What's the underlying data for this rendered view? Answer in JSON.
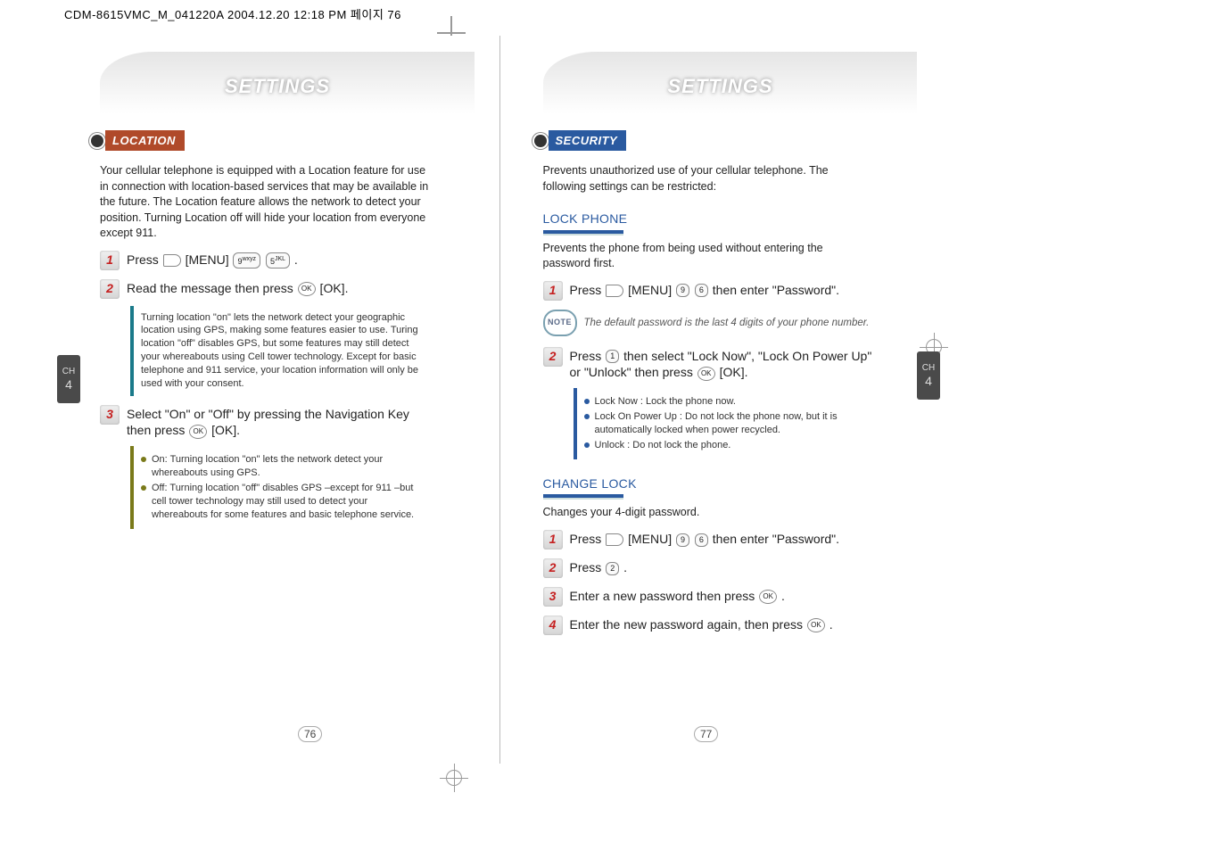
{
  "printhead": "CDM-8615VMC_M_041220A  2004.12.20 12:18 PM  페이지 76",
  "chapter": {
    "label": "CH",
    "num": "4"
  },
  "left": {
    "heading": "SETTINGS",
    "section": {
      "label": "LOCATION",
      "color": "#b04a2a"
    },
    "intro": "Your cellular telephone is equipped with a Location feature for use in connection with location-based services that may be available in the future. The Location feature allows the network to detect your position. Turning Location off will hide your location from everyone except 911.",
    "steps": [
      {
        "n": "1",
        "txt_a": "Press ",
        "txt_b": " [MENU] ",
        "keys": [
          "9",
          "5"
        ],
        "txt_c": " ."
      },
      {
        "n": "2",
        "txt_a": "Read the message then press ",
        "ok": true,
        "txt_b": " [OK]."
      },
      {
        "n": "3",
        "txt_a": "Select \"On\" or \"Off\" by pressing the Navigation Key then press ",
        "ok": true,
        "txt_b": " [OK]."
      }
    ],
    "box1": "Turning location \"on\" lets the network detect your geographic location using GPS, making some features easier to use. Turing location \"off\" disables GPS, but some features may still detect your whereabouts using Cell tower technology. Except for basic telephone and 911 service, your location information will only be used with your consent.",
    "box2": [
      "On: Turning location \"on\" lets the network detect your whereabouts using GPS.",
      "Off: Turning location \"off\" disables GPS –except for 911 –but cell tower technology may still used to detect your whereabouts for some features and basic telephone service."
    ],
    "pagenum": "76"
  },
  "right": {
    "heading": "SETTINGS",
    "section": {
      "label": "SECURITY",
      "color": "#2a5aa0"
    },
    "intro": "Prevents unauthorized use of your cellular telephone. The following settings can be restricted:",
    "lockphone": {
      "title": "LOCK PHONE",
      "desc": "Prevents the phone from being used without entering the password first.",
      "step1": {
        "n": "1",
        "txt": "Press   [MENU]    then enter \"Password\"."
      },
      "note": "The default password is the last 4 digits of your phone number.",
      "step2": {
        "n": "2",
        "txt": "Press   then select \"Lock Now\", \"Lock On Power Up\" or \"Unlock\" then press   [OK]."
      },
      "opts": [
        "Lock Now : Lock the phone now.",
        "Lock On Power Up : Do not lock the phone now, but it is automatically locked when power recycled.",
        "Unlock : Do not lock the phone."
      ]
    },
    "changelock": {
      "title": "CHANGE LOCK",
      "desc": "Changes your 4-digit password.",
      "steps": [
        {
          "n": "1",
          "txt": "Press   [MENU]    then enter \"Password\"."
        },
        {
          "n": "2",
          "txt": "Press   ."
        },
        {
          "n": "3",
          "txt": "Enter a new password then press   ."
        },
        {
          "n": "4",
          "txt": "Enter the new password again, then press   ."
        }
      ]
    },
    "pagenum": "77"
  }
}
